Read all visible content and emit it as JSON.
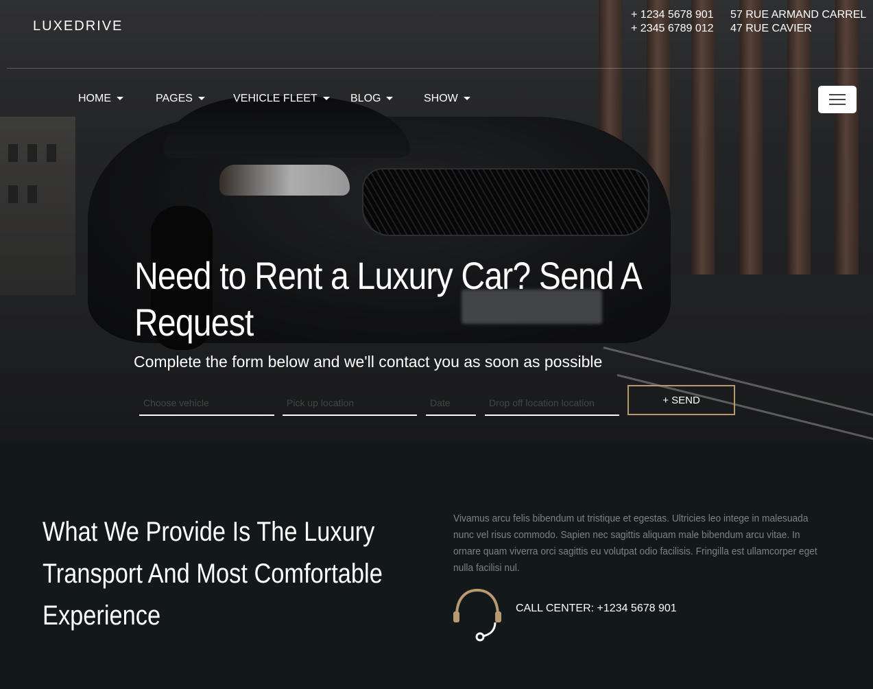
{
  "header": {
    "brand": "LUXEDRIVE",
    "phones": [
      "+ 1234 5678 901",
      "+ 2345 6789 012"
    ],
    "addresses": [
      "57 RUE ARMAND CARREL",
      "47 RUE CAVIER"
    ]
  },
  "nav": {
    "items": [
      {
        "label": "HOME"
      },
      {
        "label": "PAGES"
      },
      {
        "label": "VEHICLE FLEET"
      },
      {
        "label": "BLOG"
      },
      {
        "label": "SHOW"
      }
    ]
  },
  "hero": {
    "title": "Need to Rent a Luxury Car? Send A Request",
    "subtitle": "Complete the form below and we'll contact you as soon as possible",
    "form": {
      "field1_placeholder": "Choose vehicle",
      "field2_placeholder": "Pick up location",
      "field3_placeholder": "Date",
      "field4_placeholder": "Drop off location location",
      "send_label": "+ SEND"
    }
  },
  "about": {
    "title": "What We Provide Is The Luxury Transport And Most Comfortable Experience",
    "text": "Vivamus arcu felis bibendum ut tristique et egestas. Ultricies leo intege in malesuada nunc vel risus commodo. Sapien nec sagittis aliquam male bibendum arcu vitae. In ornare quam viverra orci sagittis eu volutpat odio facilisis. Fringilla est ullamcorper eget nulla facilisi nul.",
    "call_center": "CALL CENTER: +1234 5678 901",
    "icon": "headset-icon"
  },
  "colors": {
    "accent": "#b79a6d",
    "dark_bg": "#13181b",
    "muted_text": "#7d8286"
  }
}
